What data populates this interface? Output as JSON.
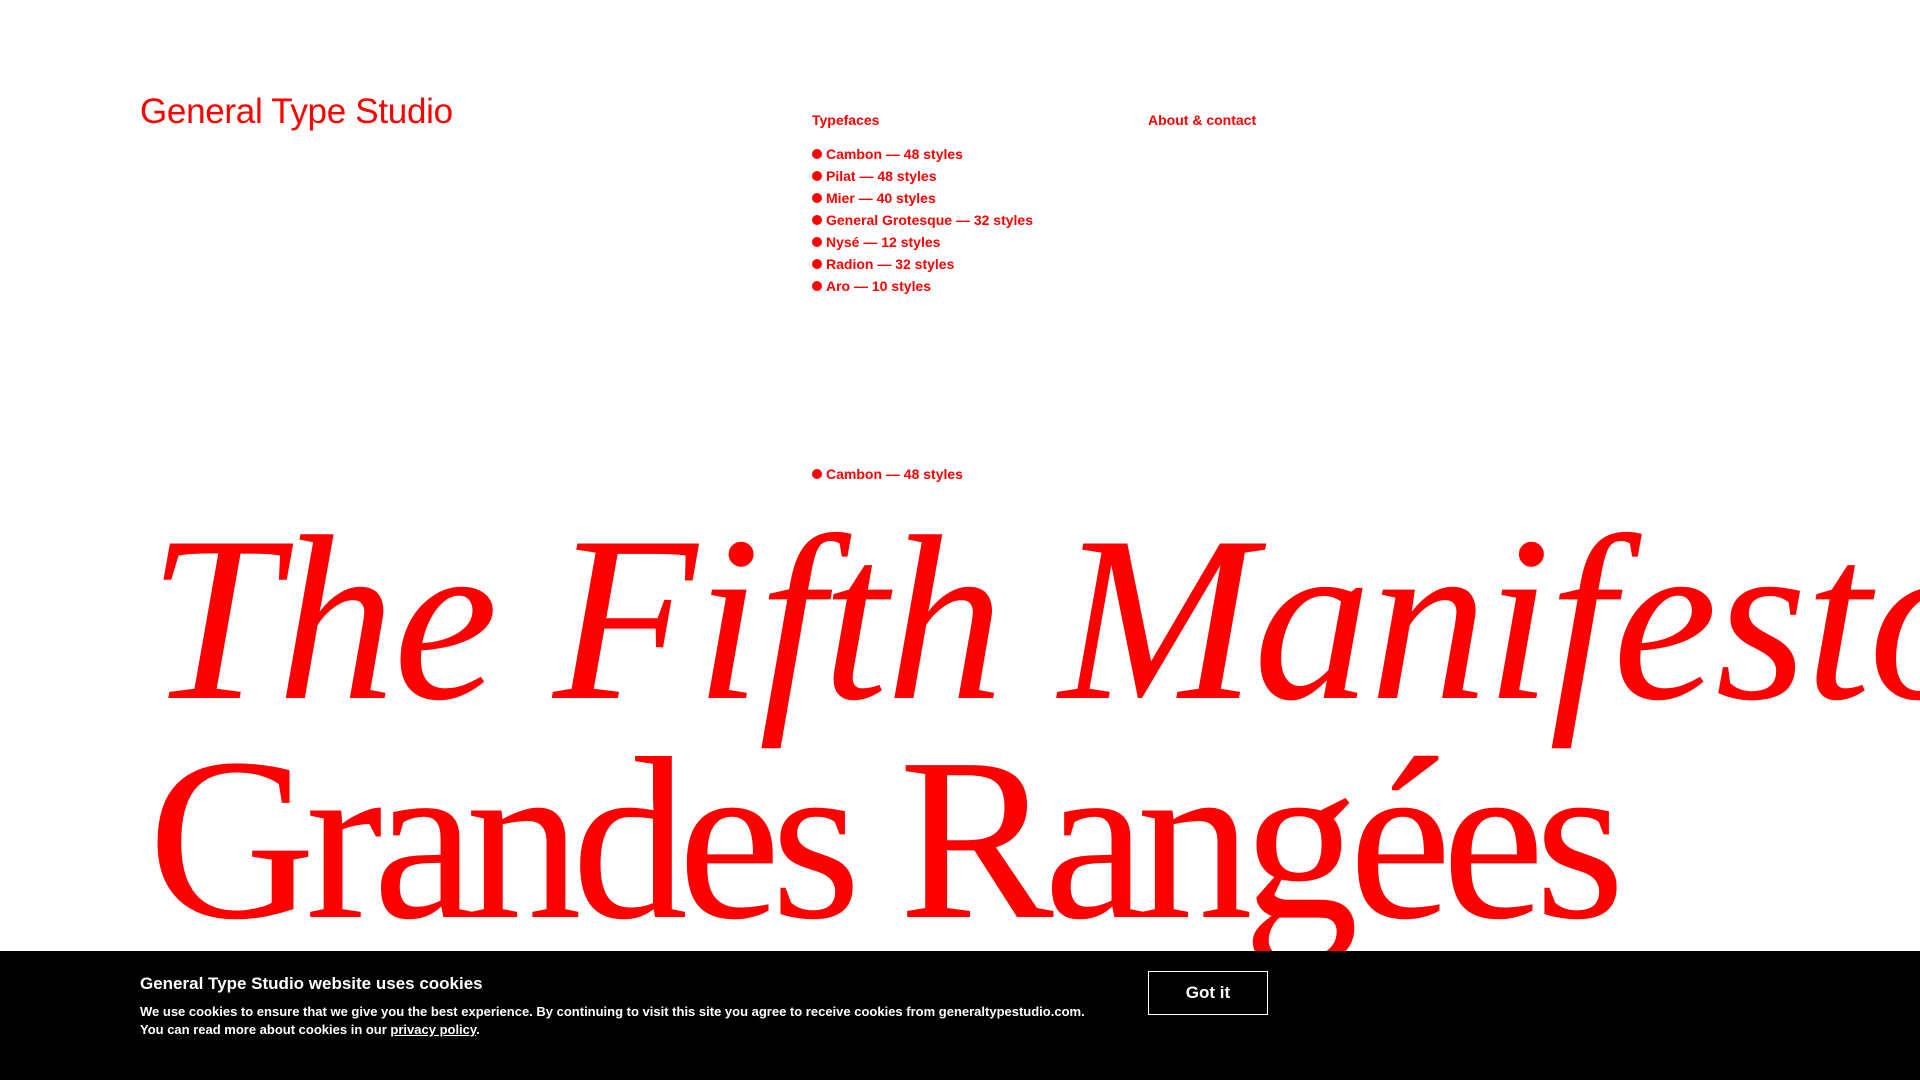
{
  "brand": {
    "name": "General Type Studio",
    "color": "#ff0000"
  },
  "nav": {
    "typefaces_label": "Typefaces",
    "about_label": "About & contact",
    "typefaces": [
      {
        "label": "Cambon — 48 styles"
      },
      {
        "label": "Pilat — 48 styles"
      },
      {
        "label": "Mier — 40 styles"
      },
      {
        "label": "General Grotesque — 32 styles"
      },
      {
        "label": "Nysé — 12 styles"
      },
      {
        "label": "Radion — 32 styles"
      },
      {
        "label": "Aro — 10 styles"
      }
    ]
  },
  "specimen": {
    "current_font": "Cambon — 48 styles",
    "line1": "The Fifth Manifesto",
    "line2": "Grandes Rangées"
  },
  "cookie": {
    "background": "#000000",
    "title": "General Type Studio website uses cookies",
    "text_before_link": "We use cookies to ensure that we give you the best experience. By continuing to visit this site you agree to receive cookies from generaltypestudio.com. You can read more about cookies in our ",
    "link_label": "privacy policy",
    "text_after_link": ".",
    "button_label": "Got it"
  }
}
